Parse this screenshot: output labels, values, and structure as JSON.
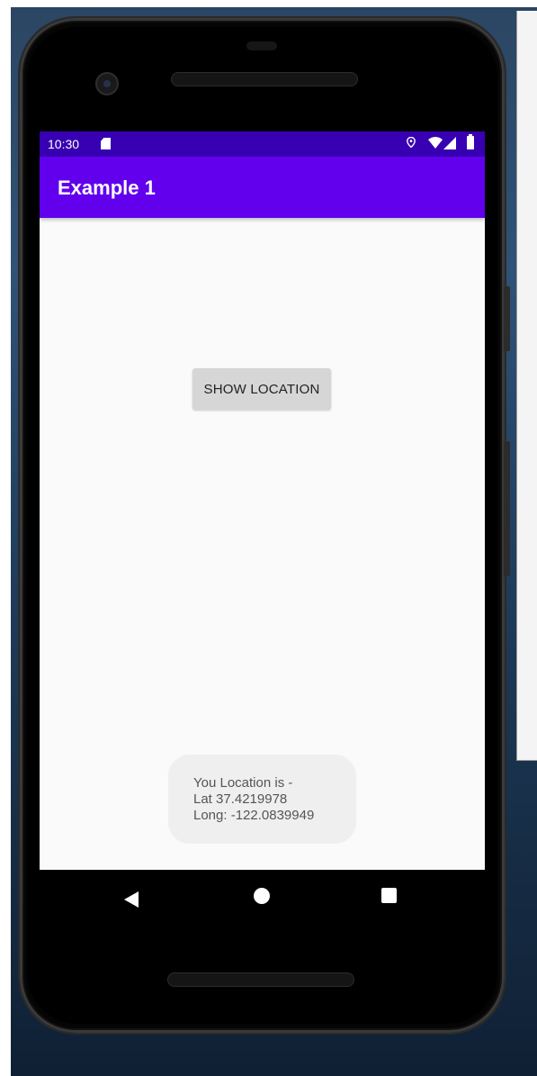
{
  "status_bar": {
    "time": "10:30",
    "icons": [
      "sd-card-icon",
      "location-icon",
      "wifi-icon",
      "signal-icon",
      "battery-icon"
    ]
  },
  "app_bar": {
    "title": "Example 1",
    "color": "#6200ee",
    "status_color": "#3700b3"
  },
  "main": {
    "show_location_button": "SHOW LOCATION"
  },
  "toast": {
    "line1": "You Location is -",
    "line2": "Lat 37.4219978",
    "line3": "Long: -122.0839949"
  },
  "nav_bar": {
    "icons": [
      "back-icon",
      "home-icon",
      "recents-icon"
    ]
  }
}
